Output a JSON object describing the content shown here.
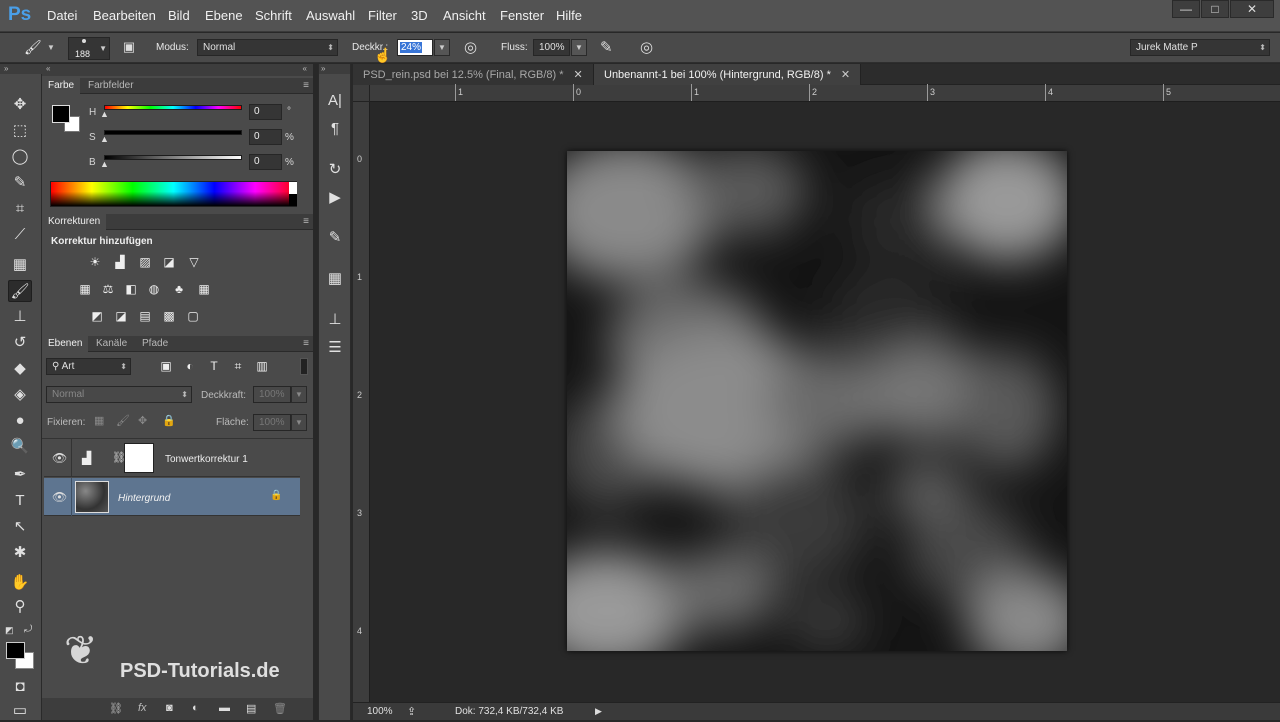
{
  "app": {
    "logo": "Ps"
  },
  "menu": [
    "Datei",
    "Bearbeiten",
    "Bild",
    "Ebene",
    "Schrift",
    "Auswahl",
    "Filter",
    "3D",
    "Ansicht",
    "Fenster",
    "Hilfe"
  ],
  "window_controls": {
    "minimize": "—",
    "restore": "□",
    "close": "✕"
  },
  "options": {
    "brush_size": "188",
    "mode_label": "Modus:",
    "mode_value": "Normal",
    "opacity_label": "Deckkr.:",
    "opacity_value": "24%",
    "flow_label": "Fluss:",
    "flow_value": "100%",
    "workspace": "Jurek Matte P"
  },
  "color_panel": {
    "tabs": [
      "Farbe",
      "Farbfelder"
    ],
    "h_label": "H",
    "h_value": "0",
    "h_unit": "°",
    "s_label": "S",
    "s_value": "0",
    "s_unit": "%",
    "b_label": "B",
    "b_value": "0",
    "b_unit": "%",
    "foreground": "#000000",
    "background": "#ffffff"
  },
  "adjustments_panel": {
    "tab": "Korrekturen",
    "heading": "Korrektur hinzufügen"
  },
  "layers_panel": {
    "tabs": [
      "Ebenen",
      "Kanäle",
      "Pfade"
    ],
    "filter_kind": "Art",
    "blend_mode": "Normal",
    "opacity_label": "Deckkraft:",
    "opacity_value": "100%",
    "lock_label": "Fixieren:",
    "fill_label": "Fläche:",
    "fill_value": "100%",
    "layers": [
      {
        "name": "Tonwertkorrektur 1",
        "selected": false
      },
      {
        "name": "Hintergrund",
        "selected": true
      }
    ]
  },
  "documents": {
    "tabs": [
      {
        "title": "PSD_rein.psd bei 12.5% (Final, RGB/8) *",
        "active": false
      },
      {
        "title": "Unbenannt-1 bei 100% (Hintergrund, RGB/8) *",
        "active": true
      }
    ],
    "ruler_h": [
      "1",
      "0",
      "1",
      "2",
      "3",
      "4",
      "5"
    ],
    "ruler_v": [
      "0",
      "1",
      "2",
      "3",
      "4"
    ]
  },
  "status": {
    "zoom": "100%",
    "doc": "Dok: 732,4 KB/732,4 KB"
  },
  "watermark": "PSD-Tutorials.de",
  "icons": [
    "move-icon",
    "marquee-icon",
    "lasso-icon",
    "quick-select-icon",
    "crop-icon",
    "eyedropper-icon",
    "healing-icon",
    "brush-icon",
    "stamp-icon",
    "history-brush-icon",
    "eraser-icon",
    "bucket-icon",
    "blur-icon",
    "dodge-icon",
    "pen-icon",
    "type-icon",
    "path-select-icon",
    "shape-icon",
    "hand-icon",
    "zoom-icon"
  ]
}
